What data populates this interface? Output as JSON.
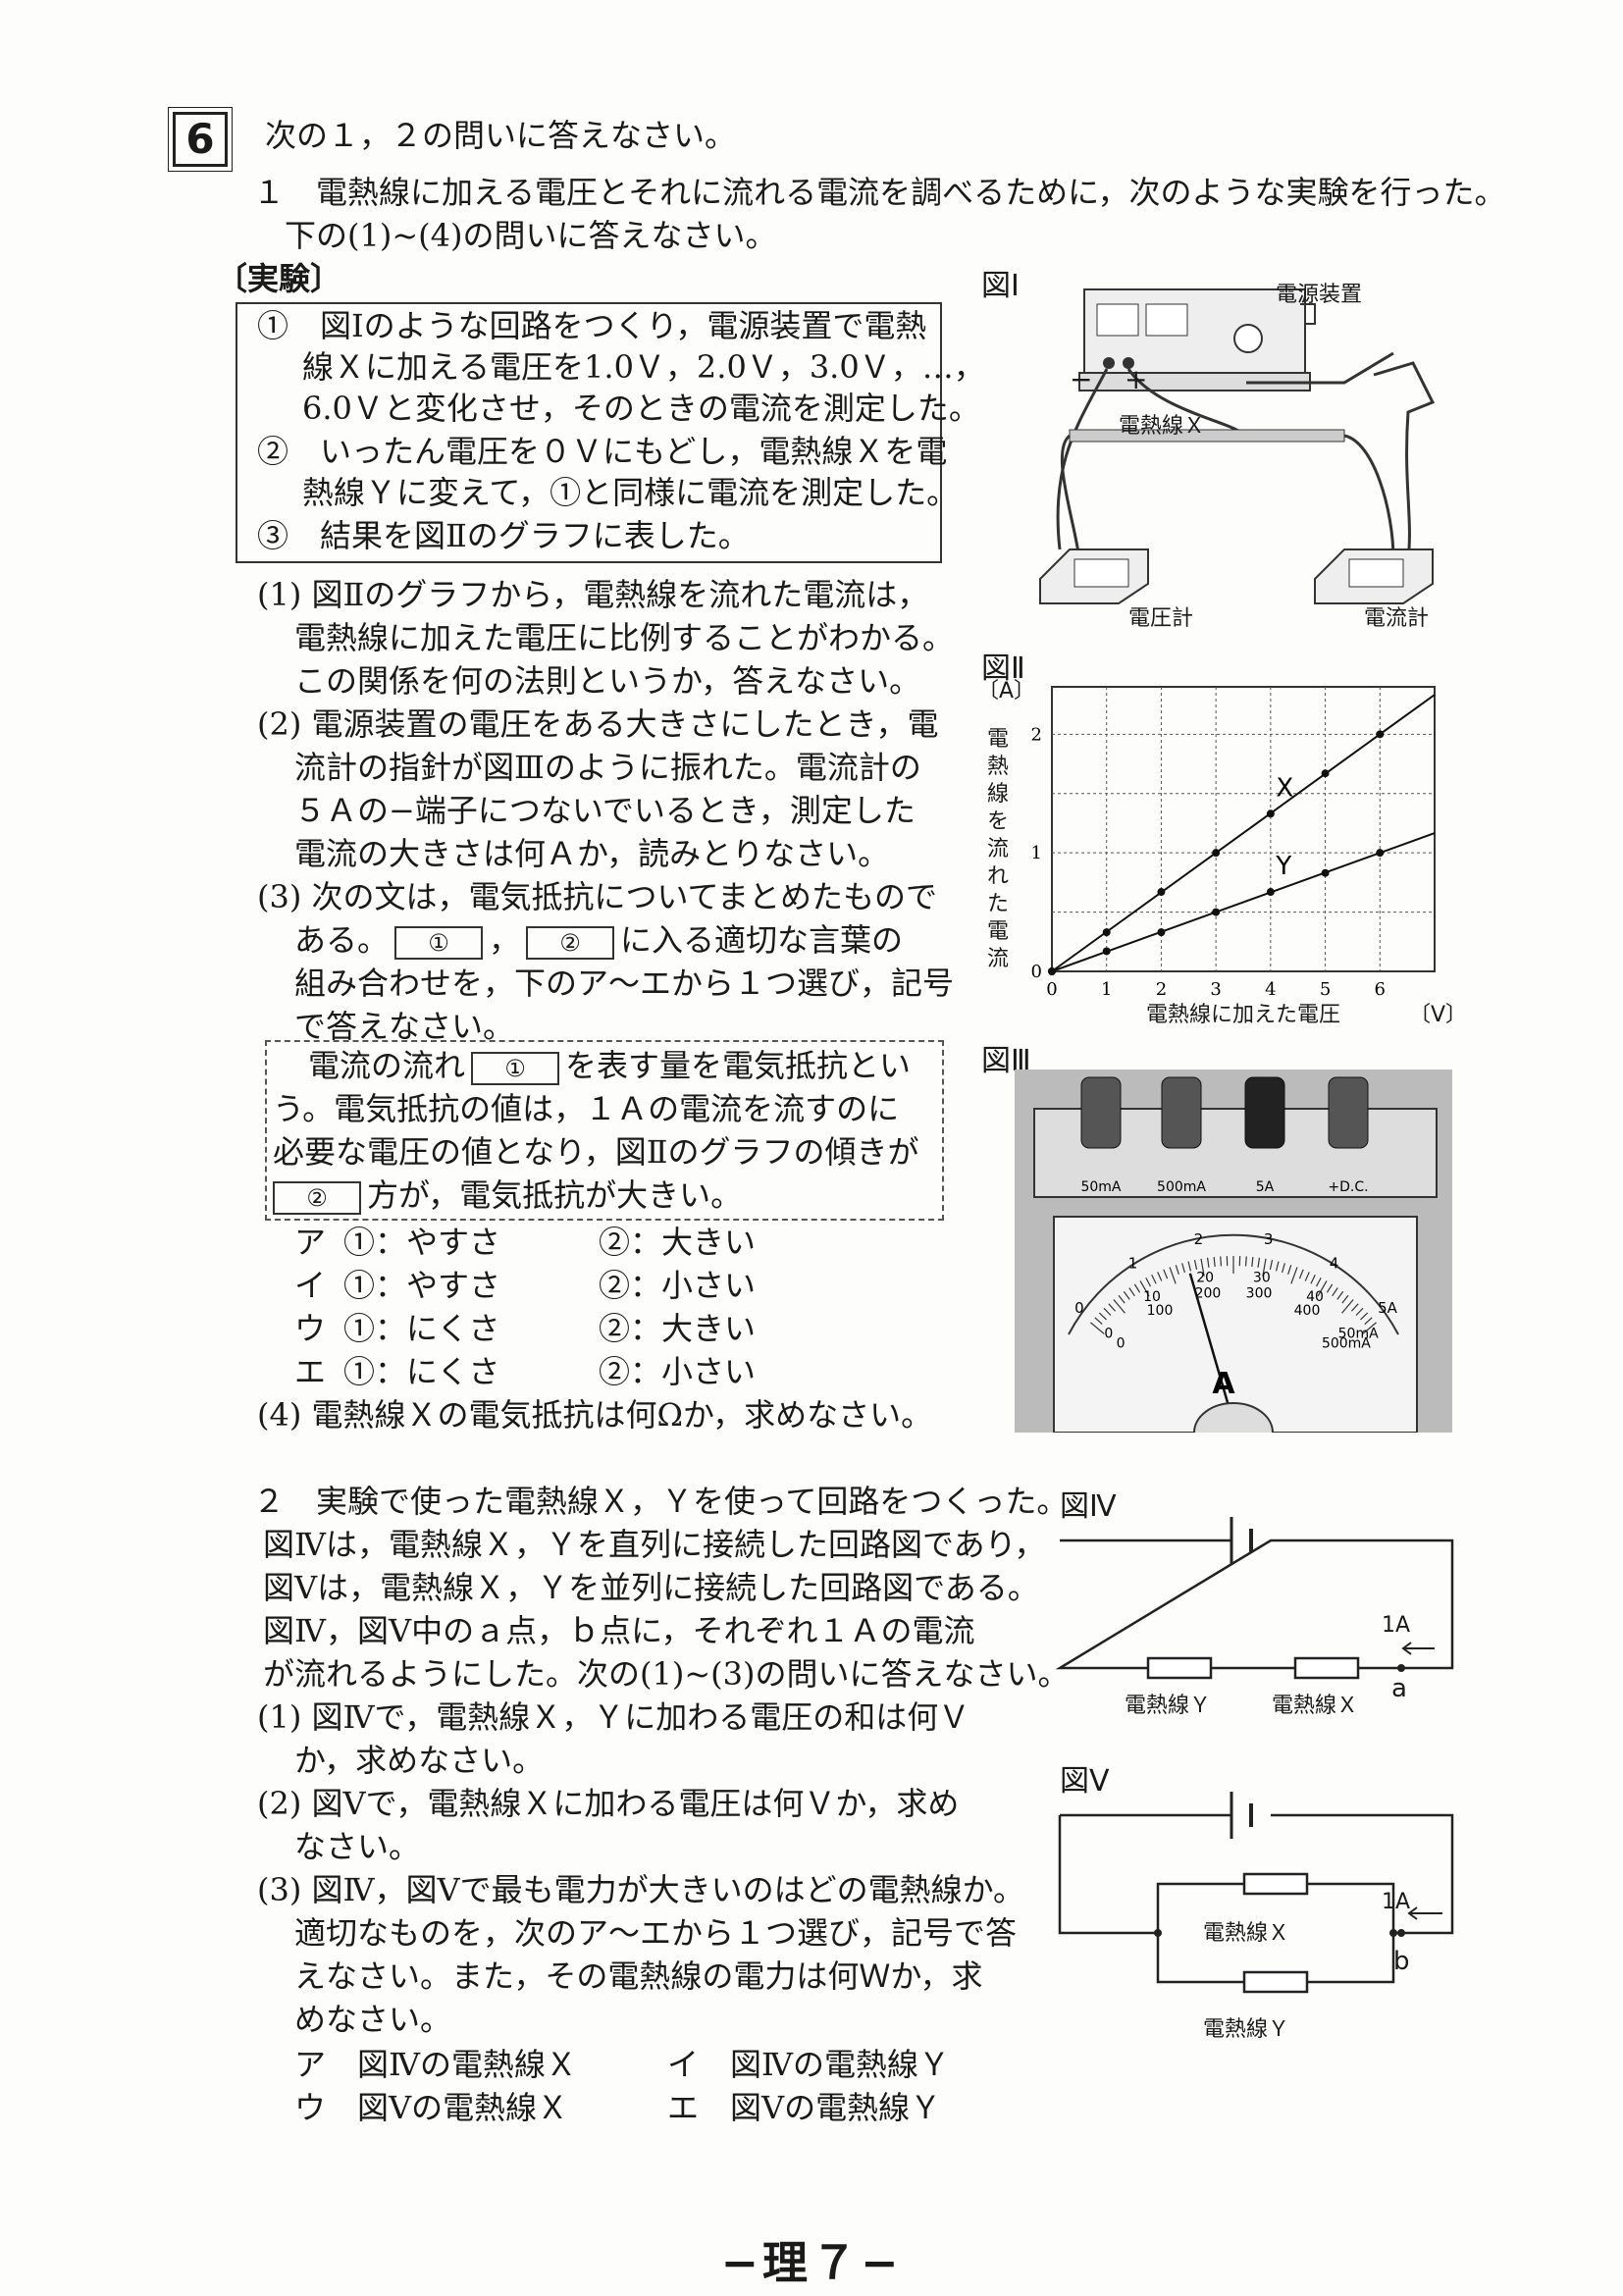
{
  "question_number": "6",
  "intro": "次の１，２の問いに答えなさい。",
  "part1": {
    "line1": "１　電熱線に加える電圧とそれに流れる電流を調べるために，次のような実験を行った。",
    "line2": "下の(1)~(4)の問いに答えなさい。",
    "experiment_label": "〔実験〕",
    "experiment": [
      "①　図Ⅰのような回路をつくり，電源装置で電熱",
      "線Ｘに加える電圧を1.0Ｖ，2.0Ｖ，3.0Ｖ，…，",
      "6.0Ｖと変化させ，そのときの電流を測定した。",
      "②　いったん電圧を０Ｖにもどし，電熱線Ｘを電",
      "熱線Ｙに変えて，①と同様に電流を測定した。",
      "③　結果を図Ⅱのグラフに表した。"
    ],
    "q1": [
      "(1)  図Ⅱのグラフから，電熱線を流れた電流は，",
      "電熱線に加えた電圧に比例することがわかる。",
      "この関係を何の法則というか，答えなさい。"
    ],
    "q2": [
      "(2)  電源装置の電圧をある大きさにしたとき，電",
      "流計の指針が図Ⅲのように振れた。電流計の",
      "５Ａの−端子につないでいるとき，測定した",
      "電流の大きさは何Ａか，読みとりなさい。"
    ],
    "q3": [
      "(3)  次の文は，電気抵抗についてまとめたもので",
      "ある。",
      "，",
      "に入る適切な言葉の",
      "組み合わせを，下のア～エから１つ選び，記号",
      "で答えなさい。"
    ],
    "blank1": "①",
    "blank2": "②",
    "summary": [
      "電流の流れ",
      "を表す量を電気抵抗とい",
      "う。電気抵抗の値は，１Ａの電流を流すのに",
      "必要な電圧の値となり，図Ⅱのグラフの傾きが",
      "方が，電気抵抗が大きい。"
    ],
    "choices": [
      {
        "k": "ア",
        "a": "①：やすさ",
        "b": "②：大きい"
      },
      {
        "k": "イ",
        "a": "①：やすさ",
        "b": "②：小さい"
      },
      {
        "k": "ウ",
        "a": "①：にくさ",
        "b": "②：大きい"
      },
      {
        "k": "エ",
        "a": "①：にくさ",
        "b": "②：小さい"
      }
    ],
    "q4": "(4)  電熱線Ｘの電気抵抗は何Ωか，求めなさい。"
  },
  "fig1": {
    "label": "図Ⅰ",
    "power": "電源装置",
    "wire_x": "電熱線Ｘ",
    "voltmeter": "電圧計",
    "ammeter": "電流計",
    "minus": "−",
    "plus": "+"
  },
  "fig2": {
    "label": "図Ⅱ",
    "ylabel": "電熱線を流れた電流",
    "yunit": "〔A〕",
    "xlabel": "電熱線に加えた電圧",
    "xunit": "〔V〕",
    "labelX": "X",
    "labelY": "Y"
  },
  "chart_data": {
    "type": "line",
    "x": [
      0,
      1,
      2,
      3,
      4,
      5,
      6
    ],
    "series": [
      {
        "name": "X",
        "values": [
          0,
          0.33,
          0.67,
          1.0,
          1.33,
          1.67,
          2.0
        ]
      },
      {
        "name": "Y",
        "values": [
          0,
          0.17,
          0.33,
          0.5,
          0.67,
          0.83,
          1.0
        ]
      }
    ],
    "xlabel": "電熱線に加えた電圧",
    "ylabel": "電熱線を流れた電流",
    "xlim": [
      0,
      7
    ],
    "ylim": [
      0,
      2.4
    ],
    "xticks": [
      "0",
      "1",
      "2",
      "3",
      "4",
      "5",
      "6"
    ],
    "yticks": [
      "0",
      "1",
      "2"
    ],
    "grid": true
  },
  "fig3": {
    "label": "図Ⅲ",
    "terminals": [
      "50mA",
      "500mA",
      "5A",
      "+D.C."
    ],
    "scale5": [
      "0",
      "1",
      "2",
      "3",
      "4",
      "5A"
    ],
    "scale500": [
      "0",
      "100",
      "200",
      "300",
      "400",
      "500mA"
    ],
    "scale50": [
      "0",
      "10",
      "20",
      "30",
      "40",
      "50mA"
    ],
    "unit": "A"
  },
  "part2": {
    "lines": [
      "２　実験で使った電熱線Ｘ，Ｙを使って回路をつくった。",
      "図Ⅳは，電熱線Ｘ，Ｙを直列に接続した回路図であり，",
      "図Ⅴは，電熱線Ｘ，Ｙを並列に接続した回路図である。",
      "図Ⅳ，図Ⅴ中のａ点，ｂ点に，それぞれ１Ａの電流",
      "が流れるようにした。次の(1)~(3)の問いに答えなさい。"
    ],
    "q1": [
      "(1)  図Ⅳで，電熱線Ｘ，Ｙに加わる電圧の和は何Ｖ",
      "か，求めなさい。"
    ],
    "q2": [
      "(2)  図Ⅴで，電熱線Ｘに加わる電圧は何Ｖか，求め",
      "なさい。"
    ],
    "q3": [
      "(3)  図Ⅳ，図Ⅴで最も電力が大きいのはどの電熱線か。",
      "適切なものを，次のア～エから１つ選び，記号で答",
      "えなさい。また，その電熱線の電力は何Ｗか，求",
      "めなさい。"
    ],
    "choices": [
      "ア　図Ⅳの電熱線Ｘ",
      "イ　図Ⅳの電熱線Ｙ",
      "ウ　図Ⅴの電熱線Ｘ",
      "エ　図Ⅴの電熱線Ｙ"
    ]
  },
  "fig4": {
    "label": "図Ⅳ",
    "current": "1A",
    "wireY": "電熱線Ｙ",
    "wireX": "電熱線Ｘ",
    "point": "a"
  },
  "fig5": {
    "label": "図Ⅴ",
    "current": "1A",
    "wireX": "電熱線Ｘ",
    "wireY": "電熱線Ｙ",
    "point": "b"
  },
  "footer": "−理７−"
}
